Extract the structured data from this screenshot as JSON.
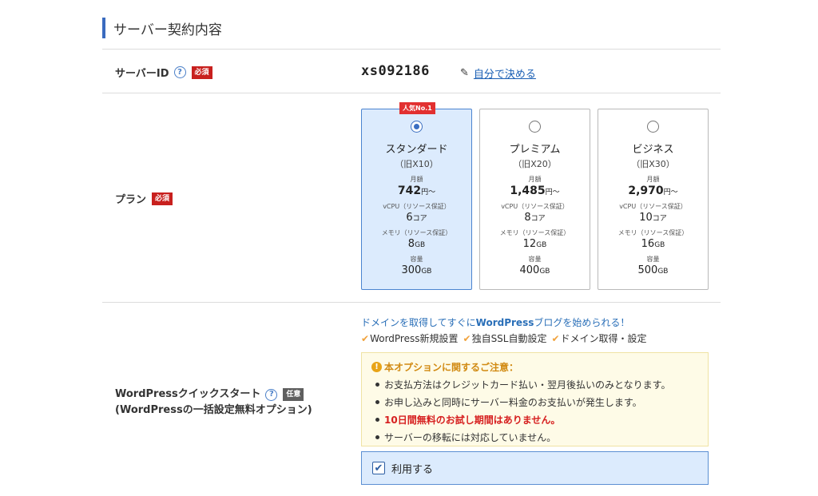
{
  "section": {
    "title": "サーバー契約内容"
  },
  "server_id": {
    "label": "サーバーID",
    "help": "?",
    "required": "必須",
    "value": "xs092186",
    "choose_link": "自分で決める",
    "pen_icon": "✎"
  },
  "plan": {
    "label": "プラン",
    "required": "必須",
    "popular_badge": "人気No.1",
    "items": [
      {
        "name": "スタンダード",
        "old": "（旧X10）",
        "price_label": "月額",
        "price": "742",
        "price_unit": "円〜",
        "vcpu_label": "vCPU（リソース保証）",
        "vcpu": "6",
        "vcpu_unit": "コア",
        "mem_label": "メモリ（リソース保証）",
        "mem": "8",
        "mem_unit": "GB",
        "cap_label": "容量",
        "cap": "300",
        "cap_unit": "GB"
      },
      {
        "name": "プレミアム",
        "old": "（旧X20）",
        "price_label": "月額",
        "price": "1,485",
        "price_unit": "円〜",
        "vcpu_label": "vCPU（リソース保証）",
        "vcpu": "8",
        "vcpu_unit": "コア",
        "mem_label": "メモリ（リソース保証）",
        "mem": "12",
        "mem_unit": "GB",
        "cap_label": "容量",
        "cap": "400",
        "cap_unit": "GB"
      },
      {
        "name": "ビジネス",
        "old": "（旧X30）",
        "price_label": "月額",
        "price": "2,970",
        "price_unit": "円〜",
        "vcpu_label": "vCPU（リソース保証）",
        "vcpu": "10",
        "vcpu_unit": "コア",
        "mem_label": "メモリ（リソース保証）",
        "mem": "16",
        "mem_unit": "GB",
        "cap_label": "容量",
        "cap": "500",
        "cap_unit": "GB"
      }
    ]
  },
  "wordpress": {
    "label_line1": "WordPressクイックスタート",
    "label_line2": "(WordPressの一括設定無料オプション)",
    "help": "?",
    "optional": "任意",
    "lead_pre": "ドメインを取得してすぐに",
    "lead_bold": "WordPress",
    "lead_post": "ブログを始められる！",
    "check_mark": "✔",
    "features": [
      "WordPress新規設置",
      "独自SSL自動設定",
      "ドメイン取得・設定"
    ],
    "notice_title": "本オプションに関するご注意：",
    "notice_icon": "!",
    "notice_items": [
      "お支払方法はクレジットカード払い・翌月後払いのみとなります。",
      "お申し込みと同時にサーバー料金のお支払いが発生します。",
      "10日間無料のお試し期間はありません。",
      "サーバーの移転には対応していません。"
    ],
    "use_label": "利用する",
    "use_checked": "✔"
  },
  "colors": {
    "accent": "#3a6bbf",
    "required": "#c8201e",
    "link": "#1a5fb4",
    "selected_bg": "#dcebfd",
    "notice_bg": "#fefbe7"
  }
}
